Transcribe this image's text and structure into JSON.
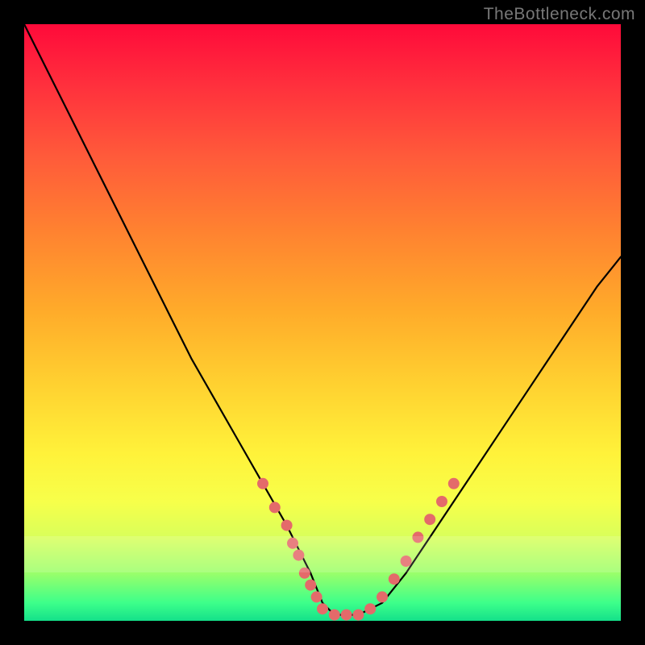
{
  "watermark": "TheBottleneck.com",
  "chart_data": {
    "type": "line",
    "title": "",
    "xlabel": "",
    "ylabel": "",
    "xlim": [
      0,
      100
    ],
    "ylim": [
      0,
      100
    ],
    "grid": false,
    "legend": false,
    "series": [
      {
        "name": "curve",
        "x": [
          0,
          4,
          8,
          12,
          16,
          20,
          24,
          28,
          32,
          36,
          40,
          44,
          48,
          50,
          52,
          54,
          56,
          60,
          64,
          68,
          72,
          76,
          80,
          84,
          88,
          92,
          96,
          100
        ],
        "y": [
          100,
          92,
          84,
          76,
          68,
          60,
          52,
          44,
          37,
          30,
          23,
          16,
          8,
          3,
          1,
          1,
          1,
          3,
          8,
          14,
          20,
          26,
          32,
          38,
          44,
          50,
          56,
          61
        ]
      }
    ],
    "markers": [
      {
        "x": 40,
        "y": 23
      },
      {
        "x": 42,
        "y": 19
      },
      {
        "x": 44,
        "y": 16
      },
      {
        "x": 45,
        "y": 13
      },
      {
        "x": 46,
        "y": 11
      },
      {
        "x": 47,
        "y": 8
      },
      {
        "x": 48,
        "y": 6
      },
      {
        "x": 49,
        "y": 4
      },
      {
        "x": 50,
        "y": 2
      },
      {
        "x": 52,
        "y": 1
      },
      {
        "x": 54,
        "y": 1
      },
      {
        "x": 56,
        "y": 1
      },
      {
        "x": 58,
        "y": 2
      },
      {
        "x": 60,
        "y": 4
      },
      {
        "x": 62,
        "y": 7
      },
      {
        "x": 64,
        "y": 10
      },
      {
        "x": 66,
        "y": 14
      },
      {
        "x": 68,
        "y": 17
      },
      {
        "x": 70,
        "y": 20
      },
      {
        "x": 72,
        "y": 23
      }
    ],
    "background_gradient": {
      "top": "#ff0a3a",
      "mid": "#ffd030",
      "bottom": "#14e08a"
    }
  }
}
